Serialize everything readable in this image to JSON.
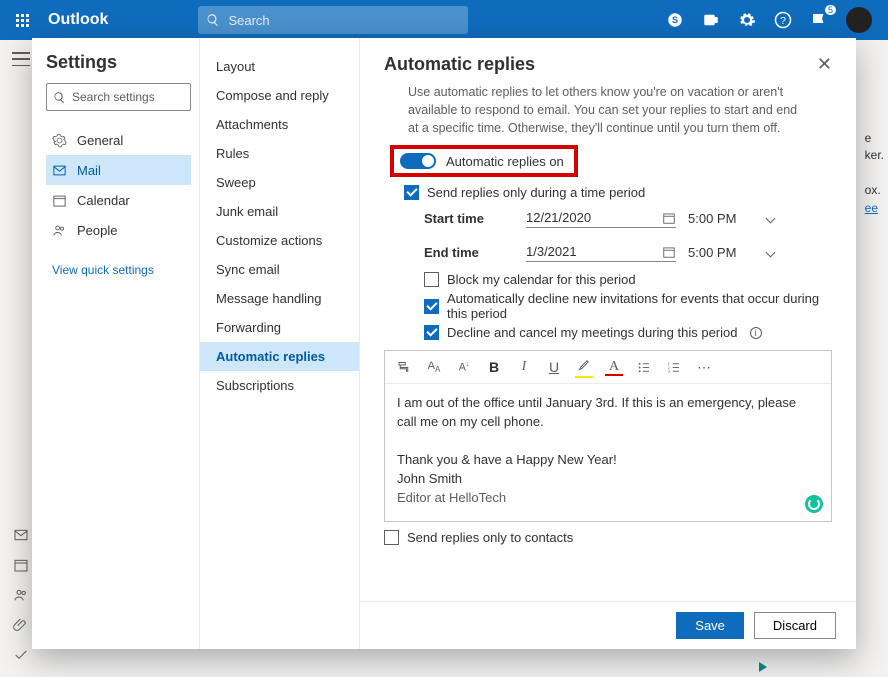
{
  "topbar": {
    "brand": "Outlook",
    "search_placeholder": "Search",
    "notif_badge": "5"
  },
  "mailhint": {
    "l1": "e",
    "l2": "ker.",
    "l3": "ox.",
    "link": "ee"
  },
  "settings": {
    "title": "Settings",
    "search_placeholder": "Search settings",
    "nav": [
      "General",
      "Mail",
      "Calendar",
      "People"
    ],
    "quick": "View quick settings"
  },
  "subnav": [
    "Layout",
    "Compose and reply",
    "Attachments",
    "Rules",
    "Sweep",
    "Junk email",
    "Customize actions",
    "Sync email",
    "Message handling",
    "Forwarding",
    "Automatic replies",
    "Subscriptions"
  ],
  "pane": {
    "title": "Automatic replies",
    "desc": "Use automatic replies to let others know you're on vacation or aren't available to respond to email. You can set your replies to start and end at a specific time. Otherwise, they'll continue until you turn them off.",
    "toggle_label": "Automatic replies on",
    "chk_period": "Send replies only during a time period",
    "start_label": "Start time",
    "start_date": "12/21/2020",
    "start_time": "5:00 PM",
    "end_label": "End time",
    "end_date": "1/3/2021",
    "end_time": "5:00 PM",
    "chk_block": "Block my calendar for this period",
    "chk_decline_new": "Automatically decline new invitations for events that occur during this period",
    "chk_cancel": "Decline and cancel my meetings during this period",
    "editor_body_1": "I am out of the office until January 3rd. If this is an emergency, please call me on my cell phone.",
    "editor_body_2": "Thank you & have a Happy New Year!",
    "editor_sig_name": "John Smith",
    "editor_sig_title": "Editor at HelloTech",
    "chk_contacts": "Send replies only to contacts",
    "save": "Save",
    "discard": "Discard"
  }
}
